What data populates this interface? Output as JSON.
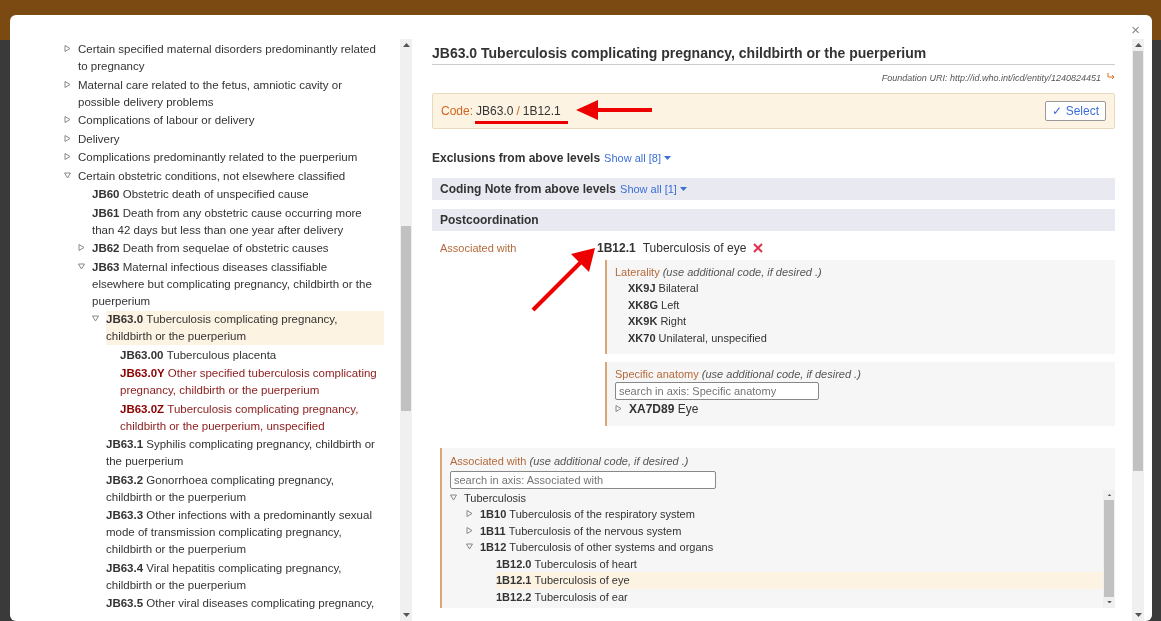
{
  "modal": {
    "close": "×"
  },
  "tree": [
    {
      "kind": "group",
      "title": "Certain specified maternal disorders predominantly related to pregnancy",
      "expanded": false,
      "selected": false
    },
    {
      "kind": "group",
      "title": "Maternal care related to the fetus, amniotic cavity or possible delivery problems",
      "expanded": false,
      "selected": false
    },
    {
      "kind": "group",
      "title": "Complications of labour or delivery",
      "expanded": false,
      "selected": false
    },
    {
      "kind": "group",
      "title": "Delivery",
      "expanded": false,
      "selected": false
    },
    {
      "kind": "group",
      "title": "Complications predominantly related to the puerperium",
      "expanded": false,
      "selected": false
    },
    {
      "kind": "group",
      "title": "Certain obstetric conditions, not elsewhere classified",
      "expanded": true,
      "selected": false,
      "children": [
        {
          "kind": "leaf",
          "code": "JB60",
          "title": "Obstetric death of unspecified cause",
          "selected": false
        },
        {
          "kind": "leaf",
          "code": "JB61",
          "title": "Death from any obstetric cause occurring more than 42 days but less than one year after delivery",
          "selected": false
        },
        {
          "kind": "group",
          "code": "JB62",
          "title": "Death from sequelae of obstetric causes",
          "expanded": false,
          "selected": false
        },
        {
          "kind": "group",
          "code": "JB63",
          "title": "Maternal infectious diseases classifiable elsewhere but complicating pregnancy, childbirth or the puerperium",
          "expanded": true,
          "selected": false,
          "children": [
            {
              "kind": "group",
              "code": "JB63.0",
              "title": "Tuberculosis complicating pregnancy, childbirth or the puerperium",
              "expanded": true,
              "selected": true,
              "children": [
                {
                  "kind": "leaf",
                  "code": "JB63.00",
                  "title": "Tuberculous placenta",
                  "selected": false
                },
                {
                  "kind": "residual",
                  "code": "JB63.0Y",
                  "title": "Other specified tuberculosis complicating pregnancy, childbirth or the puerperium",
                  "selected": false
                },
                {
                  "kind": "residual",
                  "code": "JB63.0Z",
                  "title": "Tuberculosis complicating pregnancy, childbirth or the puerperium, unspecified",
                  "selected": false
                }
              ]
            },
            {
              "kind": "leaf",
              "code": "JB63.1",
              "title": "Syphilis complicating pregnancy, childbirth or the puerperium",
              "selected": false
            },
            {
              "kind": "leaf",
              "code": "JB63.2",
              "title": "Gonorrhoea complicating pregnancy, childbirth or the puerperium",
              "selected": false
            },
            {
              "kind": "leaf",
              "code": "JB63.3",
              "title": "Other infections with a predominantly sexual mode of transmission complicating pregnancy, childbirth or the puerperium",
              "selected": false
            },
            {
              "kind": "leaf",
              "code": "JB63.4",
              "title": "Viral hepatitis complicating pregnancy, childbirth or the puerperium",
              "selected": false
            },
            {
              "kind": "leaf",
              "code": "JB63.5",
              "title": "Other viral diseases complicating pregnancy,",
              "selected": false
            }
          ]
        }
      ]
    }
  ],
  "detail": {
    "title": "JB63.0 Tuberculosis complicating pregnancy, childbirth or the puerperium",
    "foundation_uri": "Foundation URI: http://id.who.int/icd/entity/1240824451",
    "code": {
      "label": "Code:",
      "stem": "JB63.0",
      "separator": "/",
      "extension": "1B12.1"
    },
    "select_button": "✓ Select",
    "exclusions": {
      "title": "Exclusions from above levels",
      "link": "Show all [8]"
    },
    "coding_note": {
      "title": "Coding Note from above levels",
      "link": "Show all [1]"
    },
    "postcoordination": {
      "title": "Postcoordination",
      "associated": {
        "label": "Associated with",
        "code": "1B12.1",
        "title": "Tuberculosis of eye"
      },
      "axes": [
        {
          "kind": "list",
          "name": "Laterality",
          "hint": "(use additional code, if desired .)",
          "options": [
            {
              "code": "XK9J",
              "title": "Bilateral"
            },
            {
              "code": "XK8G",
              "title": "Left"
            },
            {
              "code": "XK9K",
              "title": "Right"
            },
            {
              "code": "XK70",
              "title": "Unilateral, unspecified"
            }
          ]
        },
        {
          "kind": "search",
          "name": "Specific anatomy",
          "hint": "(use additional code, if desired .)",
          "placeholder": "search in axis: Specific anatomy",
          "tree": [
            {
              "kind": "group",
              "code": "XA7D89",
              "title": "Eye",
              "expanded": false,
              "selected": false
            }
          ]
        }
      ],
      "associated_axis": {
        "name": "Associated with",
        "hint": "(use additional code, if desired .)",
        "placeholder": "search in axis: Associated with",
        "tree": [
          {
            "kind": "group",
            "title": "Tuberculosis",
            "expanded": true,
            "selected": false,
            "children": [
              {
                "kind": "group",
                "code": "1B10",
                "title": "Tuberculosis of the respiratory system",
                "expanded": false,
                "selected": false
              },
              {
                "kind": "group",
                "code": "1B11",
                "title": "Tuberculosis of the nervous system",
                "expanded": false,
                "selected": false
              },
              {
                "kind": "group",
                "code": "1B12",
                "title": "Tuberculosis of other systems and organs",
                "expanded": true,
                "selected": false,
                "children": [
                  {
                    "kind": "leaf",
                    "code": "1B12.0",
                    "title": "Tuberculosis of heart",
                    "selected": false
                  },
                  {
                    "kind": "leaf",
                    "code": "1B12.1",
                    "title": "Tuberculosis of eye",
                    "selected": true
                  },
                  {
                    "kind": "leaf",
                    "code": "1B12.2",
                    "title": "Tuberculosis of ear",
                    "selected": false
                  }
                ]
              }
            ]
          }
        ]
      }
    }
  }
}
